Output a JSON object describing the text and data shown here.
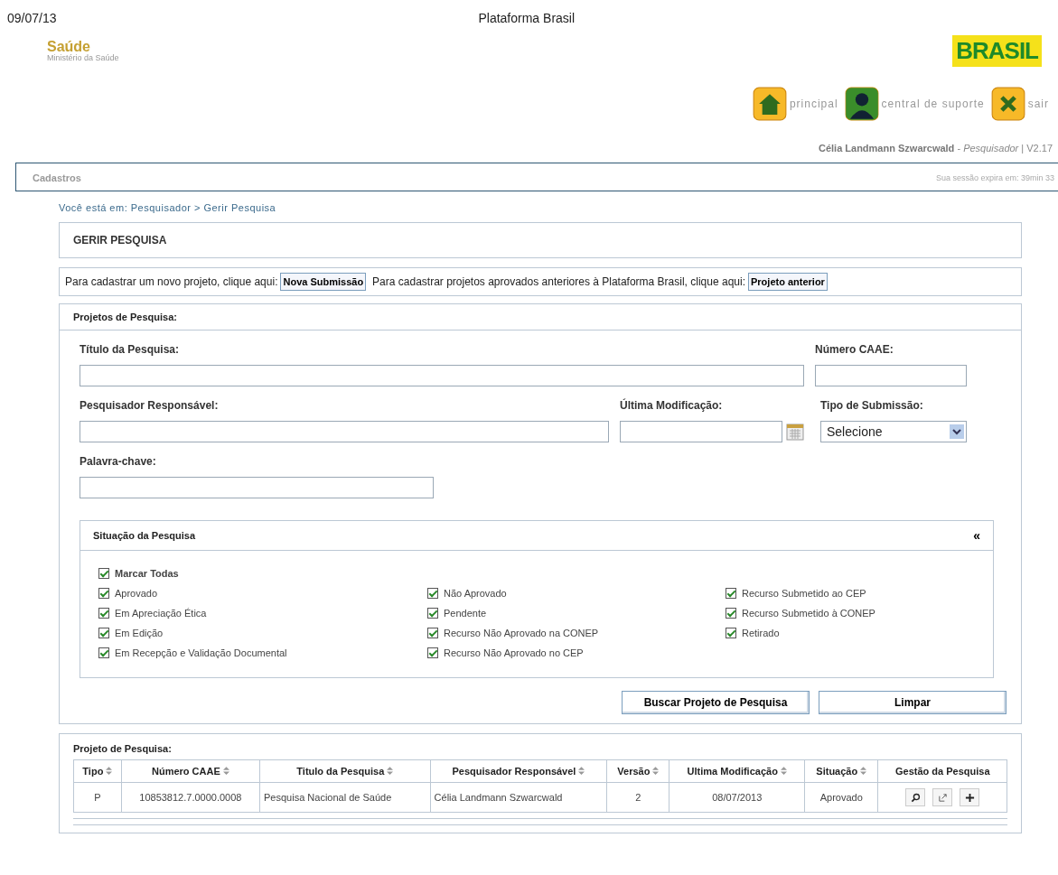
{
  "print_header": {
    "date": "09/07/13",
    "title": "Plataforma Brasil"
  },
  "logos": {
    "saude": "Saúde",
    "ministerio": "Ministério da Saúde",
    "brasil": "BRASIL"
  },
  "top_nav": [
    {
      "kind": "home",
      "label": "principal"
    },
    {
      "kind": "support",
      "label": "central de suporte"
    },
    {
      "kind": "exit",
      "label": "sair"
    }
  ],
  "user": {
    "name": "Célia Landmann Szwarcwald",
    "separator_1": "-",
    "role": "Pesquisador",
    "separator_2": "|",
    "version": "V2.17"
  },
  "menu": {
    "items": [
      "Cadastros"
    ],
    "session": "Sua sessão expira em: 39min 33"
  },
  "breadcrumb": "Você está em: Pesquisador > Gerir Pesquisa",
  "page_title": "GERIR PESQUISA",
  "submit_bar": [
    {
      "text": "Para cadastrar um novo projeto, clique aqui:",
      "button": "Nova Submissão"
    },
    {
      "text": "Para cadastrar projetos aprovados anteriores à Plataforma Brasil, clique aqui:",
      "button": "Projeto anterior"
    }
  ],
  "search": {
    "title": "Projetos de Pesquisa:",
    "fields": {
      "titulo": {
        "label": "Título da Pesquisa:"
      },
      "caae": {
        "label": "Número CAAE:"
      },
      "pesquisador": {
        "label": "Pesquisador Responsável:"
      },
      "modificacao": {
        "label": "Última Modificação:"
      },
      "tipo": {
        "label": "Tipo de Submissão:",
        "value": "Selecione"
      },
      "palavra": {
        "label": "Palavra-chave:"
      }
    },
    "situacao": {
      "title": "Situação da Pesquisa",
      "collapse": "«",
      "all": {
        "label": "Marcar Todas",
        "checked": true
      },
      "columns": [
        [
          {
            "label": "Aprovado",
            "checked": true
          },
          {
            "label": "Em Apreciação Ética",
            "checked": true
          },
          {
            "label": "Em Edição",
            "checked": true
          },
          {
            "label": "Em Recepção e Validação Documental",
            "checked": true
          }
        ],
        [
          {
            "label": "Não Aprovado",
            "checked": true
          },
          {
            "label": "Pendente",
            "checked": true
          },
          {
            "label": "Recurso Não Aprovado na CONEP",
            "checked": true
          },
          {
            "label": "Recurso Não Aprovado no CEP",
            "checked": true
          }
        ],
        [
          {
            "label": "Recurso Submetido ao CEP",
            "checked": true
          },
          {
            "label": "Recurso Submetido à CONEP",
            "checked": true
          },
          {
            "label": "Retirado",
            "checked": true
          }
        ]
      ]
    },
    "buttons": [
      "Buscar Projeto de Pesquisa",
      "Limpar"
    ]
  },
  "results": {
    "title": "Projeto de Pesquisa:",
    "columns": [
      {
        "label": "Tipo",
        "sortable": true
      },
      {
        "label": "Número CAAE",
        "sortable": true
      },
      {
        "label": "Titulo da Pesquisa",
        "sortable": true
      },
      {
        "label": "Pesquisador Responsável",
        "sortable": true
      },
      {
        "label": "Versão",
        "sortable": true
      },
      {
        "label": "Ultima Modificação",
        "sortable": true
      },
      {
        "label": "Situação",
        "sortable": true
      },
      {
        "label": "Gestão da Pesquisa",
        "sortable": false
      }
    ],
    "rows": [
      {
        "cells": [
          "P",
          "10853812.7.0000.0008",
          "Pesquisa Nacional de Saúde",
          "Célia Landmann Szwarcwald",
          "2",
          "08/07/2013",
          "Aprovado"
        ],
        "actions": [
          {
            "kind": "view"
          },
          {
            "kind": "open"
          },
          {
            "kind": "add"
          }
        ]
      }
    ]
  }
}
